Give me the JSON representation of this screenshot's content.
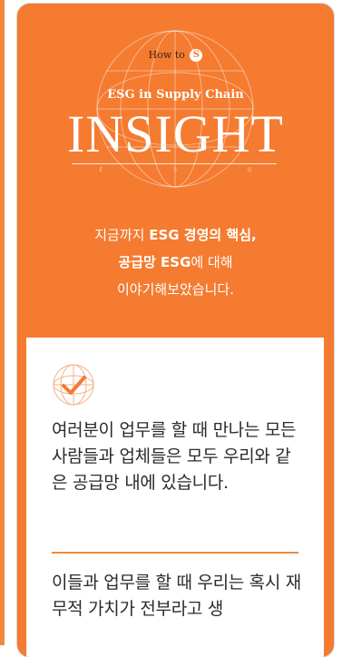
{
  "colors": {
    "accent": "#f47b30",
    "text": "#2b2b2b",
    "divider": "#f08a3c"
  },
  "hero": {
    "howto_text": "How to",
    "howto_mark": "S",
    "subtitle": "ESG in Supply Chain",
    "title": "INSIGHT",
    "esg_small": "E S G",
    "intro": {
      "line1_pre": "지금까지 ",
      "line1_bold": "ESG 경영의 핵심,",
      "line2_bold": "공급망 ESG",
      "line2_post": "에 대해",
      "line3": "이야기해보았습니다."
    }
  },
  "content": {
    "icon": "check-circle-icon",
    "paragraph1": "여러분이 업무를 할 때 만나는 모든 사람들과 업체들은 모두 우리와 같은 공급망 내에 있습니다.",
    "paragraph2": "이들과 업무를 할 때 우리는 혹시 재무적 가치가 전부라고 생"
  }
}
